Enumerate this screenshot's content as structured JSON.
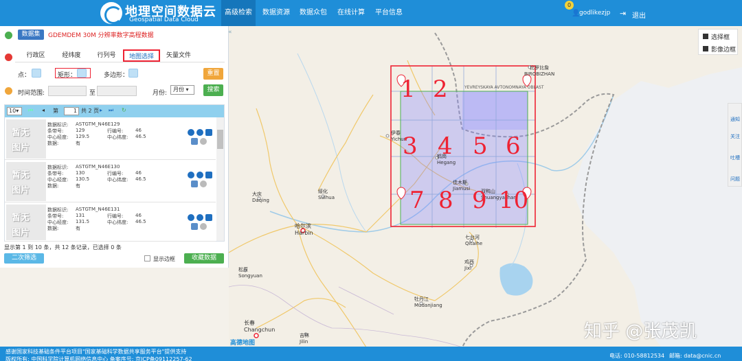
{
  "header": {
    "site_title_cn": "地理空间数据云",
    "site_title_en": "Geospatial Data Cloud",
    "nav": [
      "高级检索",
      "数据资源",
      "数据众包",
      "在线计算",
      "平台信息"
    ],
    "user_badge": "0",
    "username": "godlikezjp",
    "logout": "退出"
  },
  "panel": {
    "dataset_tag": "数据集",
    "dataset_name": "GDEMDEM 30M 分辨率数字高程数据",
    "tabs": [
      "行政区",
      "经纬度",
      "行列号",
      "地图选择",
      "矢量文件"
    ],
    "selected_tab": "地图选择",
    "point_label": "点：",
    "rect_label": "矩形：",
    "polygon_label": "多边形：",
    "reset_button": "重置",
    "search_button": "搜索",
    "time_label": "时间范围:",
    "time_to": "至",
    "month_label": "月份:",
    "month_value": "月份",
    "pager": {
      "page_size": "10",
      "page_label": "第",
      "page_value": "1",
      "page_total": "共 2 页"
    },
    "field_labels": {
      "id": "数据标识:",
      "path": "条带号:",
      "row": "行编号:",
      "lon": "中心经度:",
      "lat": "中心纬度:",
      "data": "数据:"
    },
    "placeholder": [
      "暂无",
      "图片"
    ],
    "rows": [
      {
        "id": "ASTGTM_N46E129",
        "path": "129",
        "row": "46",
        "lon": "129.5",
        "lat": "46.5",
        "data": "有"
      },
      {
        "id": "ASTGTM_N46E130",
        "path": "130",
        "row": "46",
        "lon": "130.5",
        "lat": "46.5",
        "data": "有"
      },
      {
        "id": "ASTGTM_N46E131",
        "path": "131",
        "row": "46",
        "lon": "131.5",
        "lat": "46.5",
        "data": "有"
      }
    ],
    "summary": "显示第 1 到 10 条，共 12 条记录，已选择 0 条",
    "refine_button": "二次筛选",
    "show_border": "显示边框",
    "collect_button": "收藏数据"
  },
  "map": {
    "controls": [
      "选择框",
      "影像边框"
    ],
    "cities": [
      {
        "cn": "比罗比詹",
        "en": "BIROBIZHAN"
      },
      {
        "cn": "",
        "en": "YEVREYSKAYA AVTONOMNAYA OBLAST"
      },
      {
        "cn": "伊春",
        "en": "Yichun"
      },
      {
        "cn": "鹤岗",
        "en": "Hegang"
      },
      {
        "cn": "佳木斯",
        "en": "Jiamusi"
      },
      {
        "cn": "双鸭山",
        "en": "Shuangyashan"
      },
      {
        "cn": "七台河",
        "en": "Qitaihe"
      },
      {
        "cn": "鸡西",
        "en": "Jixi"
      },
      {
        "cn": "绥化",
        "en": "Suihua"
      },
      {
        "cn": "大庆",
        "en": "Daqing"
      },
      {
        "cn": "哈尔滨",
        "en": "Harbin"
      },
      {
        "cn": "松原",
        "en": "Songyuan"
      },
      {
        "cn": "牡丹江",
        "en": "Mudanjiang"
      },
      {
        "cn": "长春",
        "en": "Changchun"
      },
      {
        "cn": "吉林",
        "en": "Jilin"
      }
    ],
    "tile_numbers": [
      "1",
      "2",
      "3",
      "4",
      "5",
      "6",
      "7",
      "8",
      "9",
      "10"
    ],
    "side_tools": [
      "通知",
      "关注",
      "吐槽",
      "问题"
    ],
    "watermark": "知乎 @张茂凯",
    "brand": "高德地图"
  },
  "footer": {
    "line1": "感谢国家科技基础条件平台项目\"国家基础科学数据共享服务平台\"提供支持",
    "line2": "版权所有: 中国科学院计算机网络信息中心 备案序号: 京ICP备09112257-62",
    "tel": "电话: 010-58812534",
    "mail": "邮箱: data@cnic.cn"
  },
  "colors": {
    "header": "#1f8ed8",
    "select_border": "#e23",
    "tile_fill": "#7f7fff",
    "tile_border": "#4caf50"
  }
}
